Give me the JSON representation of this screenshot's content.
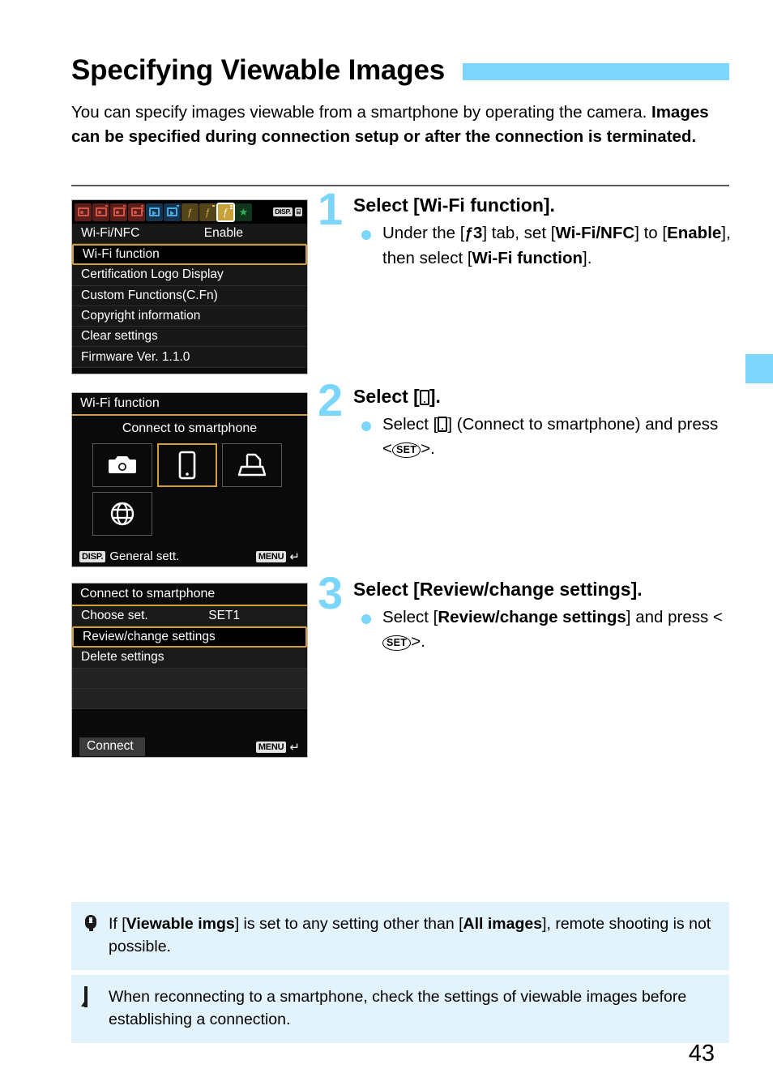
{
  "page": {
    "title": "Specifying Viewable Images",
    "number": "43",
    "accent_color": "#7cd5fa",
    "note_bg_color": "#e2f3fc"
  },
  "intro": {
    "plain": "You can specify images viewable from a smartphone by operating the camera. ",
    "bold": "Images can be specified during connection setup or after the connection is terminated."
  },
  "lcd1": {
    "name": "setup-menu-screen",
    "tabs": [
      {
        "kind": "shooting",
        "selected": false
      },
      {
        "kind": "shooting",
        "selected": false
      },
      {
        "kind": "shooting",
        "selected": false
      },
      {
        "kind": "shooting",
        "selected": false
      },
      {
        "kind": "playback",
        "selected": false
      },
      {
        "kind": "playback",
        "selected": false
      },
      {
        "kind": "setup",
        "selected": false
      },
      {
        "kind": "setup",
        "selected": false
      },
      {
        "kind": "setup",
        "selected": true
      },
      {
        "kind": "mymenu",
        "selected": false
      }
    ],
    "corner": {
      "disp": "DISP.",
      "grid": "⌸"
    },
    "rows": [
      {
        "label": "Wi-Fi/NFC",
        "value": "Enable",
        "highlighted": false
      },
      {
        "label": "Wi-Fi function",
        "value": "",
        "highlighted": true
      },
      {
        "label": "Certification Logo Display",
        "value": "",
        "highlighted": false
      },
      {
        "label": "Custom Functions(C.Fn)",
        "value": "",
        "highlighted": false
      },
      {
        "label": "Copyright information",
        "value": "",
        "highlighted": false
      },
      {
        "label": "Clear settings",
        "value": "",
        "highlighted": false
      },
      {
        "label": "Firmware Ver. 1.1.0",
        "value": "",
        "highlighted": false
      }
    ]
  },
  "lcd2": {
    "name": "wifi-function-screen",
    "header": "Wi-Fi function",
    "subtitle": "Connect to smartphone",
    "cells": [
      {
        "icon": "camera-icon",
        "selected": false
      },
      {
        "icon": "smartphone-icon",
        "selected": true
      },
      {
        "icon": "printer-icon",
        "selected": false
      },
      {
        "icon": "globe-icon",
        "selected": false
      }
    ],
    "footer_left_chip": "DISP.",
    "footer_left_label": "General sett.",
    "footer_right_chip": "MENU",
    "footer_right_arrow": "↵"
  },
  "lcd3": {
    "name": "connect-to-smartphone-screen",
    "header": "Connect to smartphone",
    "rows": [
      {
        "label": "Choose set.",
        "value": "SET1",
        "highlighted": false
      },
      {
        "label": "Review/change settings",
        "value": "",
        "highlighted": true
      },
      {
        "label": "Delete settings",
        "value": "",
        "highlighted": false
      },
      {
        "label": "",
        "value": "",
        "highlighted": false
      },
      {
        "label": "",
        "value": "",
        "highlighted": false
      }
    ],
    "connect_button": "Connect",
    "footer_right_chip": "MENU",
    "footer_right_arrow": "↵"
  },
  "steps": [
    {
      "number": "1",
      "title": "Select [Wi-Fi function].",
      "body_parts": [
        {
          "t": "text",
          "v": "Under the ["
        },
        {
          "t": "wrench",
          "v": "ƒ"
        },
        {
          "t": "bold",
          "v": "3"
        },
        {
          "t": "text",
          "v": "] tab, set ["
        },
        {
          "t": "bold",
          "v": "Wi-Fi/NFC"
        },
        {
          "t": "text",
          "v": "] to ["
        },
        {
          "t": "bold",
          "v": "Enable"
        },
        {
          "t": "text",
          "v": "], then select ["
        },
        {
          "t": "bold",
          "v": "Wi-Fi function"
        },
        {
          "t": "text",
          "v": "]."
        }
      ]
    },
    {
      "number": "2",
      "title_prefix": "Select [",
      "title_icon": "smartphone-icon",
      "title_suffix": "].",
      "body_prefix": "Select [",
      "body_icon": "smartphone-icon",
      "body_mid": "] (Connect to smartphone) and press <",
      "body_set": "SET",
      "body_suffix": ">."
    },
    {
      "number": "3",
      "title": "Select [Review/change settings].",
      "body_prefix": "Select [",
      "body_bold": "Review/change settings",
      "body_mid": "] and press <",
      "body_set": "SET",
      "body_suffix": ">."
    }
  ],
  "notes": [
    {
      "icon": "caution-icon",
      "parts": [
        {
          "t": "text",
          "v": "If ["
        },
        {
          "t": "bold",
          "v": "Viewable imgs"
        },
        {
          "t": "text",
          "v": "] is set to any setting other than ["
        },
        {
          "t": "bold",
          "v": "All images"
        },
        {
          "t": "text",
          "v": "], remote shooting is not possible."
        }
      ]
    },
    {
      "icon": "note-icon",
      "parts": [
        {
          "t": "text",
          "v": "When reconnecting to a smartphone, check the settings of viewable images before establishing a connection."
        }
      ]
    }
  ]
}
